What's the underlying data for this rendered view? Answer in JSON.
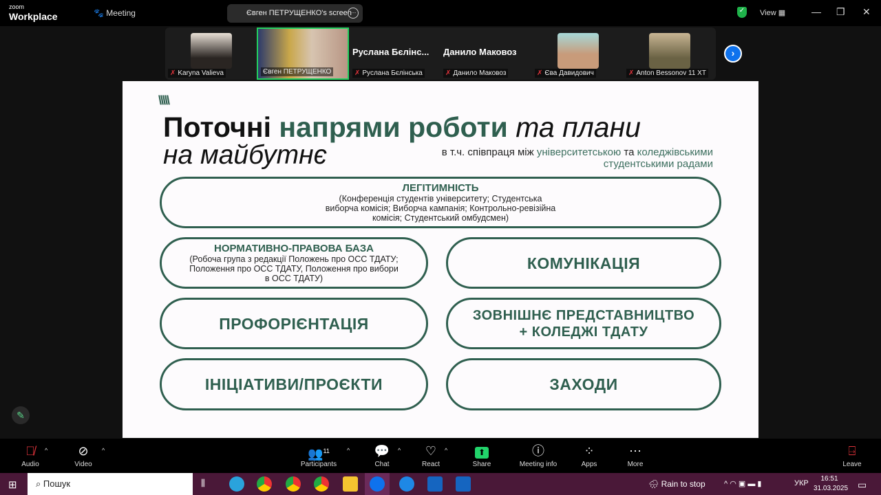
{
  "zoom": {
    "logo_small": "zoom",
    "logo_big": "Workplace",
    "meeting": "Meeting",
    "share_label": "Євген ПЕТРУЩЕНКО's screen",
    "view": "View"
  },
  "participants": [
    {
      "name": "Karyna Valieva",
      "muted": true
    },
    {
      "name": "Євген ПЕТРУЩЕНКО",
      "muted": false,
      "active": true
    },
    {
      "name": "Руслана Бєлінська",
      "display": "Руслана  Бєлінс...",
      "muted": true
    },
    {
      "name": "Данило Маковоз",
      "display": "Данило Маковоз",
      "muted": true
    },
    {
      "name": "Єва Давидович",
      "muted": true
    },
    {
      "name": "Anton Bessonov 11 XT",
      "muted": true
    }
  ],
  "slide": {
    "title_black": "Поточні",
    "title_green": "напрями роботи",
    "title_italic": "та плани",
    "title_line2": "на майбутнє",
    "sub_a": "в т.ч. співпраця між",
    "sub_b": "університетською",
    "sub_c": "та",
    "sub_d": "коледжівськими",
    "sub_e": "студентськими радами",
    "boxes": [
      {
        "title": "ЛЕГІТИМНІСТЬ",
        "desc": "(Конференція студентів університету; Студентська\nвиборча комісія; Виборча кампанія; Контрольно-ревізійна\nкомісія; Студентський омбудсмен)"
      },
      {
        "title": "НОРМАТИВНО-ПРАВОВА БАЗА",
        "desc": "(Робоча група з редакції Положень про ОСС ТДАТУ;\nПоложення про ОСС ТДАТУ, Положення про вибори\nв ОСС ТДАТУ)"
      },
      {
        "title": "КОМУНІКАЦІЯ"
      },
      {
        "title": "ПРОФОРІЄНТАЦІЯ"
      },
      {
        "title": "ЗОВНІШНЄ ПРЕДСТАВНИЦТВО\n+ КОЛЕДЖІ ТДАТУ"
      },
      {
        "title": "ІНІЦІАТИВИ/ПРОЄКТИ"
      },
      {
        "title": "ЗАХОДИ"
      }
    ]
  },
  "toolbar": {
    "audio": "Audio",
    "video": "Video",
    "participants": "Participants",
    "participants_count": "11",
    "chat": "Chat",
    "react": "React",
    "share": "Share",
    "meeting_info": "Meeting info",
    "apps": "Apps",
    "more": "More",
    "leave": "Leave"
  },
  "taskbar": {
    "search": "Пошук",
    "weather": "Rain to stop",
    "lang": "УКР",
    "time": "16:51",
    "date": "31.03.2025"
  }
}
